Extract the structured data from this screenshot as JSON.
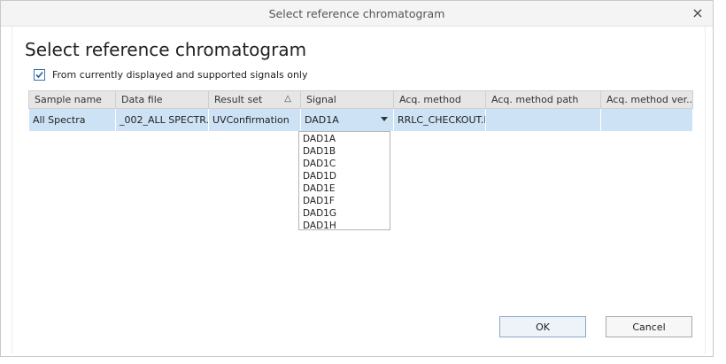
{
  "window": {
    "title": "Select reference chromatogram",
    "close_icon": "×"
  },
  "dialog": {
    "heading": "Select reference chromatogram",
    "checkbox": {
      "label": "From currently displayed and supported signals only",
      "checked": true
    }
  },
  "grid": {
    "columns": [
      "Sample name",
      "Data file",
      "Result set",
      "Signal",
      "Acq. method",
      "Acq. method path",
      "Acq. method ver..."
    ],
    "sort_indicator": "△",
    "row": {
      "sample_name": "All Spectra",
      "data_file": "_002_ALL SPECTR...",
      "result_set": "UVConfirmation",
      "signal": "DAD1A",
      "acq_method": "RRLC_CHECKOUT.M",
      "acq_method_path": "",
      "acq_method_version": ""
    }
  },
  "signal_options": [
    "DAD1A",
    "DAD1B",
    "DAD1C",
    "DAD1D",
    "DAD1E",
    "DAD1F",
    "DAD1G",
    "DAD1H"
  ],
  "buttons": {
    "ok": "OK",
    "cancel": "Cancel"
  },
  "colors": {
    "selected_row": "#cde3f5",
    "header": "#e6e6e6",
    "ok_border": "#8aa9c8"
  }
}
